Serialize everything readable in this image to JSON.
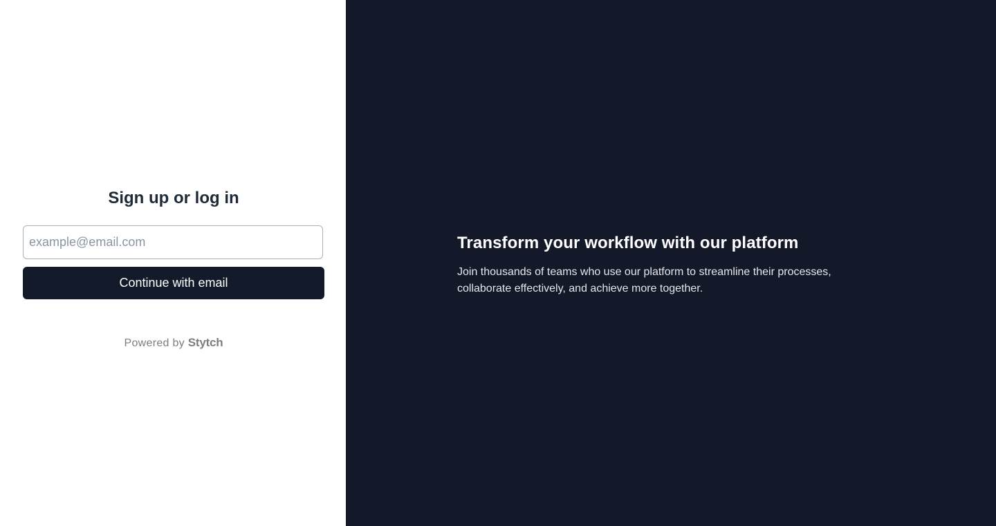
{
  "auth": {
    "title": "Sign up or log in",
    "email_placeholder": "example@email.com",
    "email_value": "",
    "continue_label": "Continue with email",
    "powered_by_prefix": "Powered by",
    "powered_by_brand": "Stytch"
  },
  "promo": {
    "title": "Transform your workflow with our platform",
    "body": "Join thousands of teams who use our platform to streamline their processes, collaborate effectively, and achieve more together."
  },
  "colors": {
    "left_background": "#ffffff",
    "right_background": "#131929",
    "button_background": "#131a29",
    "title_text": "#1e2a38",
    "muted_text": "#7d7d7d"
  }
}
